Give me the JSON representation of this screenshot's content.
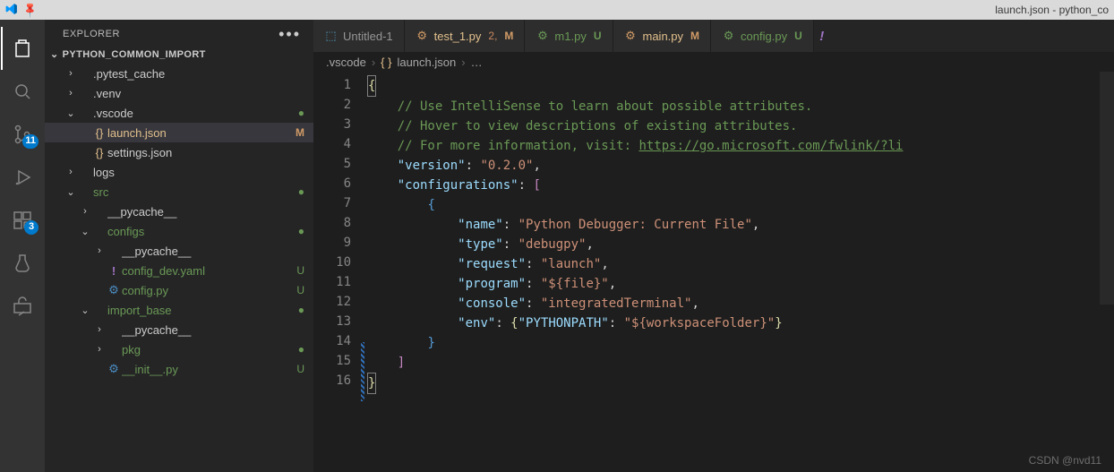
{
  "window": {
    "title": "launch.json - python_co"
  },
  "activity": {
    "scm_badge": "11",
    "ext_badge": "3"
  },
  "explorer": {
    "header": "EXPLORER",
    "project": "PYTHON_COMMON_IMPORT",
    "items": [
      {
        "indent": 1,
        "chev": "›",
        "icon": "",
        "label": ".pytest_cache",
        "status": "",
        "cls": ""
      },
      {
        "indent": 1,
        "chev": "›",
        "icon": "",
        "label": ".venv",
        "status": "",
        "cls": ""
      },
      {
        "indent": 1,
        "chev": "⌄",
        "icon": "",
        "label": ".vscode",
        "status": "●",
        "cls": "",
        "statusCls": "dot-dirty"
      },
      {
        "indent": 2,
        "chev": "",
        "icon": "{}",
        "label": "launch.json",
        "status": "M",
        "cls": "orange selected",
        "iconCls": "braces",
        "statusCls": "mod"
      },
      {
        "indent": 2,
        "chev": "",
        "icon": "{}",
        "label": "settings.json",
        "status": "",
        "cls": "",
        "iconCls": "braces"
      },
      {
        "indent": 1,
        "chev": "›",
        "icon": "",
        "label": "logs",
        "status": "",
        "cls": ""
      },
      {
        "indent": 1,
        "chev": "⌄",
        "icon": "",
        "label": "src",
        "status": "●",
        "cls": "green",
        "statusCls": "dot-dirty"
      },
      {
        "indent": 2,
        "chev": "›",
        "icon": "",
        "label": "__pycache__",
        "status": "",
        "cls": ""
      },
      {
        "indent": 2,
        "chev": "⌄",
        "icon": "",
        "label": "configs",
        "status": "●",
        "cls": "green",
        "statusCls": "dot-dirty"
      },
      {
        "indent": 3,
        "chev": "›",
        "icon": "",
        "label": "__pycache__",
        "status": "",
        "cls": ""
      },
      {
        "indent": 3,
        "chev": "",
        "icon": "!",
        "label": "config_dev.yaml",
        "status": "U",
        "cls": "green",
        "iconCls": "purple",
        "statusCls": "green"
      },
      {
        "indent": 3,
        "chev": "",
        "icon": "⚙",
        "label": "config.py",
        "status": "U",
        "cls": "green",
        "iconCls": "pyfile",
        "statusCls": "green"
      },
      {
        "indent": 2,
        "chev": "⌄",
        "icon": "",
        "label": "import_base",
        "status": "●",
        "cls": "green",
        "statusCls": "dot-dirty"
      },
      {
        "indent": 3,
        "chev": "›",
        "icon": "",
        "label": "__pycache__",
        "status": "",
        "cls": ""
      },
      {
        "indent": 3,
        "chev": "›",
        "icon": "",
        "label": "pkg",
        "status": "●",
        "cls": "green",
        "statusCls": "dot-dirty"
      },
      {
        "indent": 3,
        "chev": "",
        "icon": "⚙",
        "label": "__init__.py",
        "status": "U",
        "cls": "green",
        "iconCls": "pyfile",
        "statusCls": "green"
      }
    ]
  },
  "tabs": [
    {
      "icon": "⬚",
      "iconColor": "#519aba",
      "label": "Untitled-1",
      "badges": [],
      "active": false
    },
    {
      "icon": "⚙",
      "iconColor": "#d19a66",
      "label": "test_1.py",
      "badges": [
        {
          "txt": "2,",
          "cls": "tnum"
        },
        {
          "txt": "M",
          "cls": "tM"
        }
      ],
      "labelCls": "orange",
      "active": false
    },
    {
      "icon": "⚙",
      "iconColor": "#6a9955",
      "label": "m1.py",
      "badges": [
        {
          "txt": "U",
          "cls": "tU"
        }
      ],
      "labelCls": "green",
      "active": false
    },
    {
      "icon": "⚙",
      "iconColor": "#d19a66",
      "label": "main.py",
      "badges": [
        {
          "txt": "M",
          "cls": "tM"
        }
      ],
      "labelCls": "orange",
      "active": false
    },
    {
      "icon": "⚙",
      "iconColor": "#6a9955",
      "label": "config.py",
      "badges": [
        {
          "txt": "U",
          "cls": "tU"
        }
      ],
      "labelCls": "green",
      "active": false
    }
  ],
  "breadcrumb": {
    "folder": ".vscode",
    "file": "launch.json",
    "tail": "…"
  },
  "code": {
    "lines": 16,
    "comment1": "// Use IntelliSense to learn about possible attributes.",
    "comment2": "// Hover to view descriptions of existing attributes.",
    "comment3a": "// For more information, visit: ",
    "comment3b": "https://go.microsoft.com/fwlink/?li",
    "version_key": "\"version\"",
    "version_val": "\"0.2.0\"",
    "config_key": "\"configurations\"",
    "name_key": "\"name\"",
    "name_val": "\"Python Debugger: Current File\"",
    "type_key": "\"type\"",
    "type_val": "\"debugpy\"",
    "request_key": "\"request\"",
    "request_val": "\"launch\"",
    "program_key": "\"program\"",
    "program_val": "\"${file}\"",
    "console_key": "\"console\"",
    "console_val": "\"integratedTerminal\"",
    "env_key": "\"env\"",
    "pp_key": "\"PYTHONPATH\"",
    "pp_val": "\"${workspaceFolder}\""
  },
  "watermark": "CSDN @nvd11"
}
